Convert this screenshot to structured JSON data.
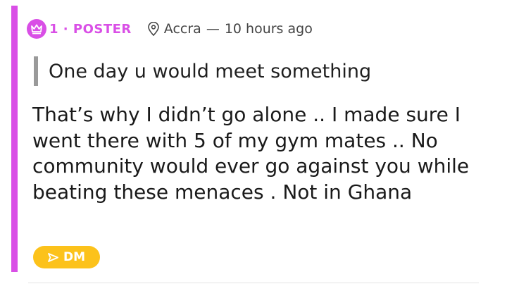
{
  "post": {
    "rank_label": "1 · POSTER",
    "location": "Accra",
    "separator": "—",
    "time_ago": "10 hours ago",
    "quoted_text": "One day u would meet something",
    "body": "That’s why I didn’t go alone .. I made sure I went there with 5 of my gym mates .. No community would ever go against you while beating these menaces . Not in Ghana",
    "dm_label": "DM"
  },
  "colors": {
    "accent": "#d94fe6",
    "dm_button": "#fcc21b",
    "quote_bar": "#9a9a9a"
  },
  "icons": {
    "badge": "crown-icon",
    "location": "location-pin-icon",
    "dm": "send-arrow-icon"
  }
}
